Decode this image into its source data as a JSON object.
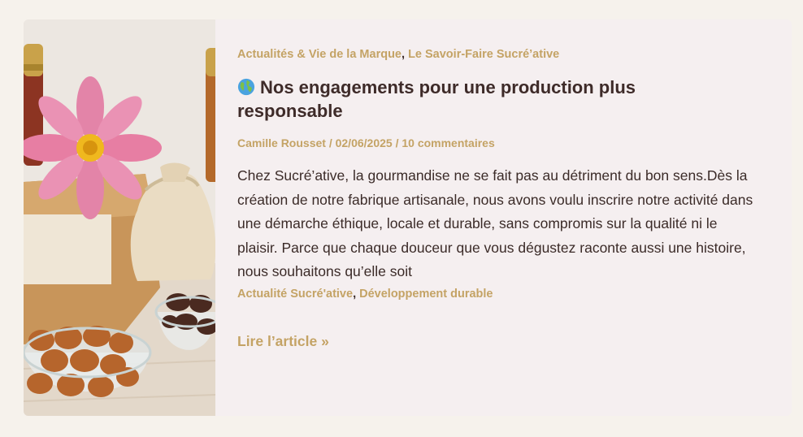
{
  "post": {
    "categories": [
      "Actualités & Vie de la Marque",
      "Le Savoir-Faire Sucré’ative"
    ],
    "category_separator": ",",
    "title": "Nos engagements pour une production plus responsable",
    "title_icon": "globe-icon",
    "author": "Camille Rousset",
    "date": "02/06/2025",
    "comments": "10 commentaires",
    "meta_separator": " / ",
    "excerpt": "Chez Sucré’ative, la gourmandise ne se fait pas au détriment du bon sens.Dès la création de notre fabrique artisanale, nous avons voulu inscrire notre activité dans une démarche éthique, locale et durable, sans compromis sur la qualité ni le plaisir. Parce que chaque douceur que vous dégustez raconte aussi une histoire, nous souhaitons qu’elle soit",
    "tags": [
      "Actualité Sucré'ative",
      "Développement durable"
    ],
    "tag_separator": ",",
    "read_more": "Lire l’article »"
  },
  "colors": {
    "page_background": "#f6f2ec",
    "card_background": "#f5eff0",
    "accent_gold": "#c4a365",
    "text_dark": "#3b2b28"
  }
}
